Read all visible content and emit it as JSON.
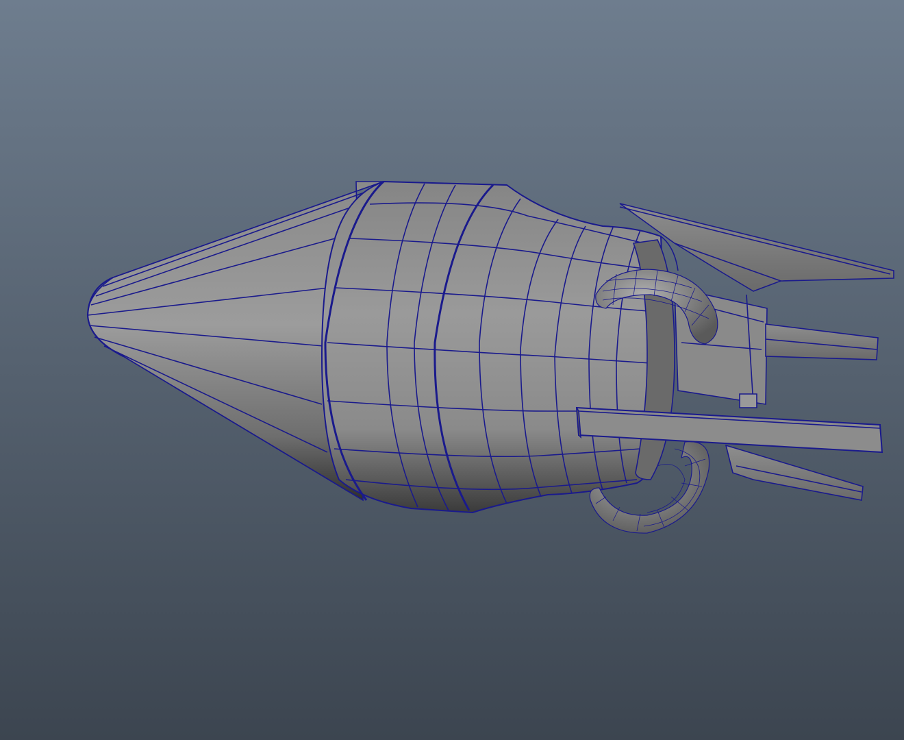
{
  "viewport": {
    "background_top": "#6e7d8e",
    "background_bottom": "#3c4550"
  },
  "model": {
    "wireframe_color": "#1a1a8c",
    "shade_light": "#9a9a9a",
    "shade_mid": "#7e7e7e",
    "shade_dark": "#3f3f3f",
    "display_mode": "wireframe-on-shaded"
  }
}
